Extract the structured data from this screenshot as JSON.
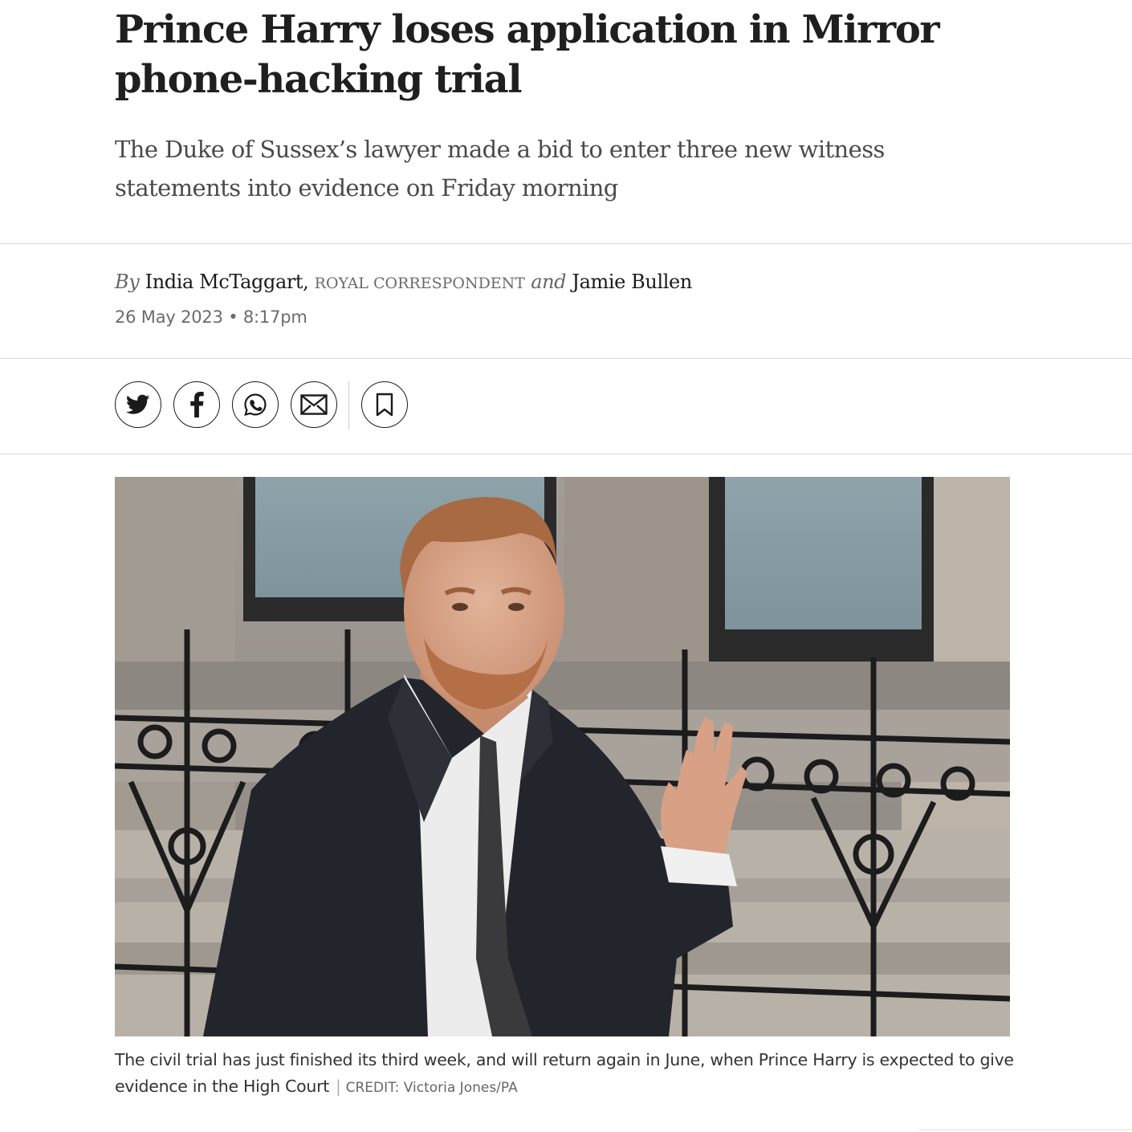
{
  "article": {
    "headline": "Prince Harry loses application in Mirror phone-hacking trial",
    "standfirst": "The Duke of Sussex’s lawyer made a bid to enter three new witness statements into evidence on Friday morning",
    "byline": {
      "by": "By",
      "author1": "India McTaggart,",
      "author1_role": "ROYAL CORRESPONDENT",
      "and": "and",
      "author2": "Jamie Bullen"
    },
    "date": "26 May 2023 • 8:17pm"
  },
  "share": {
    "icons": [
      "twitter-icon",
      "facebook-icon",
      "whatsapp-icon",
      "email-icon",
      "bookmark-icon"
    ]
  },
  "image": {
    "caption": "The civil trial has just finished its third week, and will return again in June, when Prince Harry is expected to give evidence in the High Court",
    "credit_separator": "|",
    "credit": "CREDIT: Victoria Jones/PA"
  },
  "colors": {
    "text": "#1f1f1f",
    "muted": "#6b6b6b",
    "rule": "#d9d9d9"
  }
}
